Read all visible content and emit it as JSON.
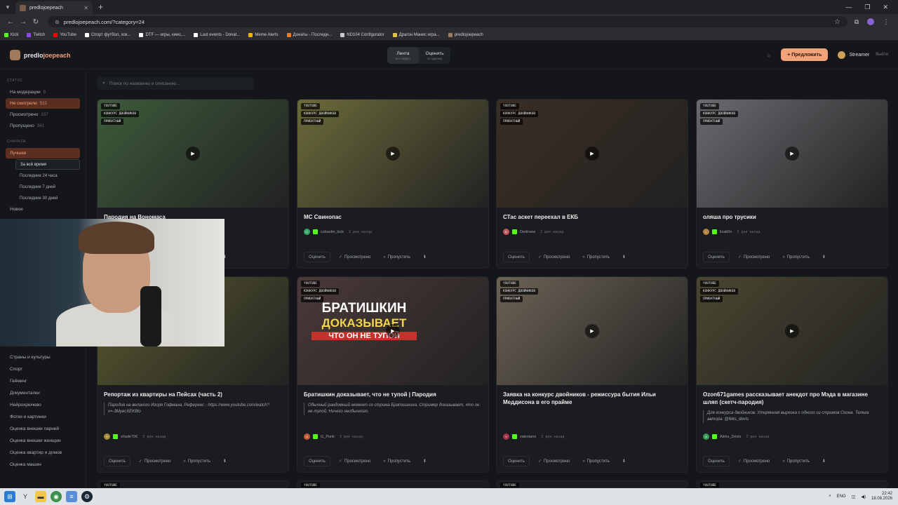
{
  "browser": {
    "tab_title": "predlojoepeach",
    "url": "predlojoepeach.com/?category=24",
    "bookmarks": [
      {
        "label": "Kick",
        "color": "#53fc18"
      },
      {
        "label": "Twitch",
        "color": "#9146ff"
      },
      {
        "label": "YouTube",
        "color": "#ff0000"
      },
      {
        "label": "Спорт футбол, хок...",
        "color": "#ffffff"
      },
      {
        "label": "DTF — игры, кино,...",
        "color": "#ffffff"
      },
      {
        "label": "Last events - Donat...",
        "color": "#ffffff"
      },
      {
        "label": "Meme Alerts",
        "color": "#f0b400"
      },
      {
        "label": "Донаты - Последн...",
        "color": "#f07a1a"
      },
      {
        "label": "ND104 Configurator",
        "color": "#cccccc"
      },
      {
        "label": "Драгон Манис игра...",
        "color": "#e0c040"
      },
      {
        "label": "predlojoepeach",
        "color": "#a27b5c"
      }
    ]
  },
  "header": {
    "logo_main": "predlo",
    "logo_accent": "joepeach",
    "tabs": [
      {
        "label": "Лента",
        "sub": "все видео"
      },
      {
        "label": "Оценить",
        "sub": "по одному"
      }
    ],
    "suggest_label": "+ Предложить",
    "user_name": "Streamer",
    "logout": "Выйти"
  },
  "sidebar": {
    "status_title": "СТАТУС",
    "status_items": [
      {
        "label": "На модерации",
        "count": "8"
      },
      {
        "label": "Не смотрели",
        "count": "513"
      },
      {
        "label": "Просмотрено",
        "count": "337"
      },
      {
        "label": "Пропущено",
        "count": "341"
      }
    ],
    "sort_title": "СНАЧАЛА",
    "best_label": "Лучшее",
    "periods": [
      "За всё время",
      "Последние 24 часа",
      "Последние 7 дней",
      "Последние 30 дней"
    ],
    "new_label": "Новое",
    "categories": [
      "Страны и культуры",
      "Спорт",
      "Гейминг",
      "Документалки",
      "Нейрохрючево",
      "Фотки и картинки",
      "Оценка внешки парней",
      "Оценка внешки женщин",
      "Оценка квартир и домов",
      "Оценка машин"
    ]
  },
  "search": {
    "placeholder": "Поиск по названию и описанию..."
  },
  "actions": {
    "rate": "Оценить",
    "watched": "Просмотрено",
    "skip": "Пропустить"
  },
  "badges": {
    "source": "YOUTUBE",
    "contest": "КОНКУРС ДВОЙНИКОВ",
    "private": "ПРИВАТНЫЙ"
  },
  "cards": [
    {
      "title": "Пародия на Вономаса",
      "desc": "",
      "user": "",
      "initial": "",
      "time": "",
      "color": "#55606a",
      "thumb": "#3d5a3a"
    },
    {
      "title": "МС Свинопас",
      "desc": "",
      "user": "cobaslm_kick",
      "initial": "C",
      "time": "2 дня назад",
      "color": "#3aa56a",
      "thumb": "#6b6a3a"
    },
    {
      "title": "СТас аскет переехал в ЕКБ",
      "desc": "",
      "user": "Dedrowa",
      "initial": "D",
      "time": "2 дня назад",
      "color": "#c25a5a",
      "thumb": "#3a2e24"
    },
    {
      "title": "оляша про трусики",
      "desc": "",
      "user": "lizab0n",
      "initial": "L",
      "time": "3 дня назад",
      "color": "#b7823a",
      "thumb": "#6a6a70"
    },
    {
      "title": "Репортаж из квартиры на Пейсах (часть 2)",
      "desc": "Пародия на великого Игоря Гофмана. Референс - https://www.youtube.com/watch?v=-3MyecXEKBlo",
      "user": "shade796",
      "initial": "S",
      "time": "3 дня назад",
      "color": "#a38a35",
      "thumb": "#5a5a30"
    },
    {
      "title": "Братишкин доказывает, что не тупой | Пародия",
      "desc": "Обычный рандомный момент со стрима Братишкина. Стример доказывает, что он не тупой. Ничего необычного.",
      "user": "G_Punk",
      "initial": "G",
      "time": "3 дня назад",
      "color": "#c05a3a",
      "thumb": "#4a3a38"
    },
    {
      "title": "Заявка на конкурс двойников - режиссура бытия Ильи Меддисона в его прайме",
      "desc": "",
      "user": "valexiano",
      "initial": "V",
      "time": "3 дня назад",
      "color": "#a8324a",
      "thumb": "#6b6255"
    },
    {
      "title": "Ozon671games рассказывает анекдот про Мэда в магазине шляп (скетч-пародия)",
      "desc": "Для конкурса двойников. Утерянная вырезка с одного из стримов Озона. Телега автора: @feks_devis",
      "user": "Aleks_Devis",
      "initial": "A",
      "time": "3 дня назад",
      "color": "#3a9a5a",
      "thumb": "#4a4630"
    }
  ],
  "thumb_overlay": {
    "line1": "БРАТИШКИН",
    "line2": "ДОКАЗЫВАЕТ",
    "line3": "ЧТО ОН НЕ ТУПОЙ"
  },
  "taskbar": {
    "lang": "ENG",
    "time": "22:42",
    "date": "18.08.2026"
  }
}
